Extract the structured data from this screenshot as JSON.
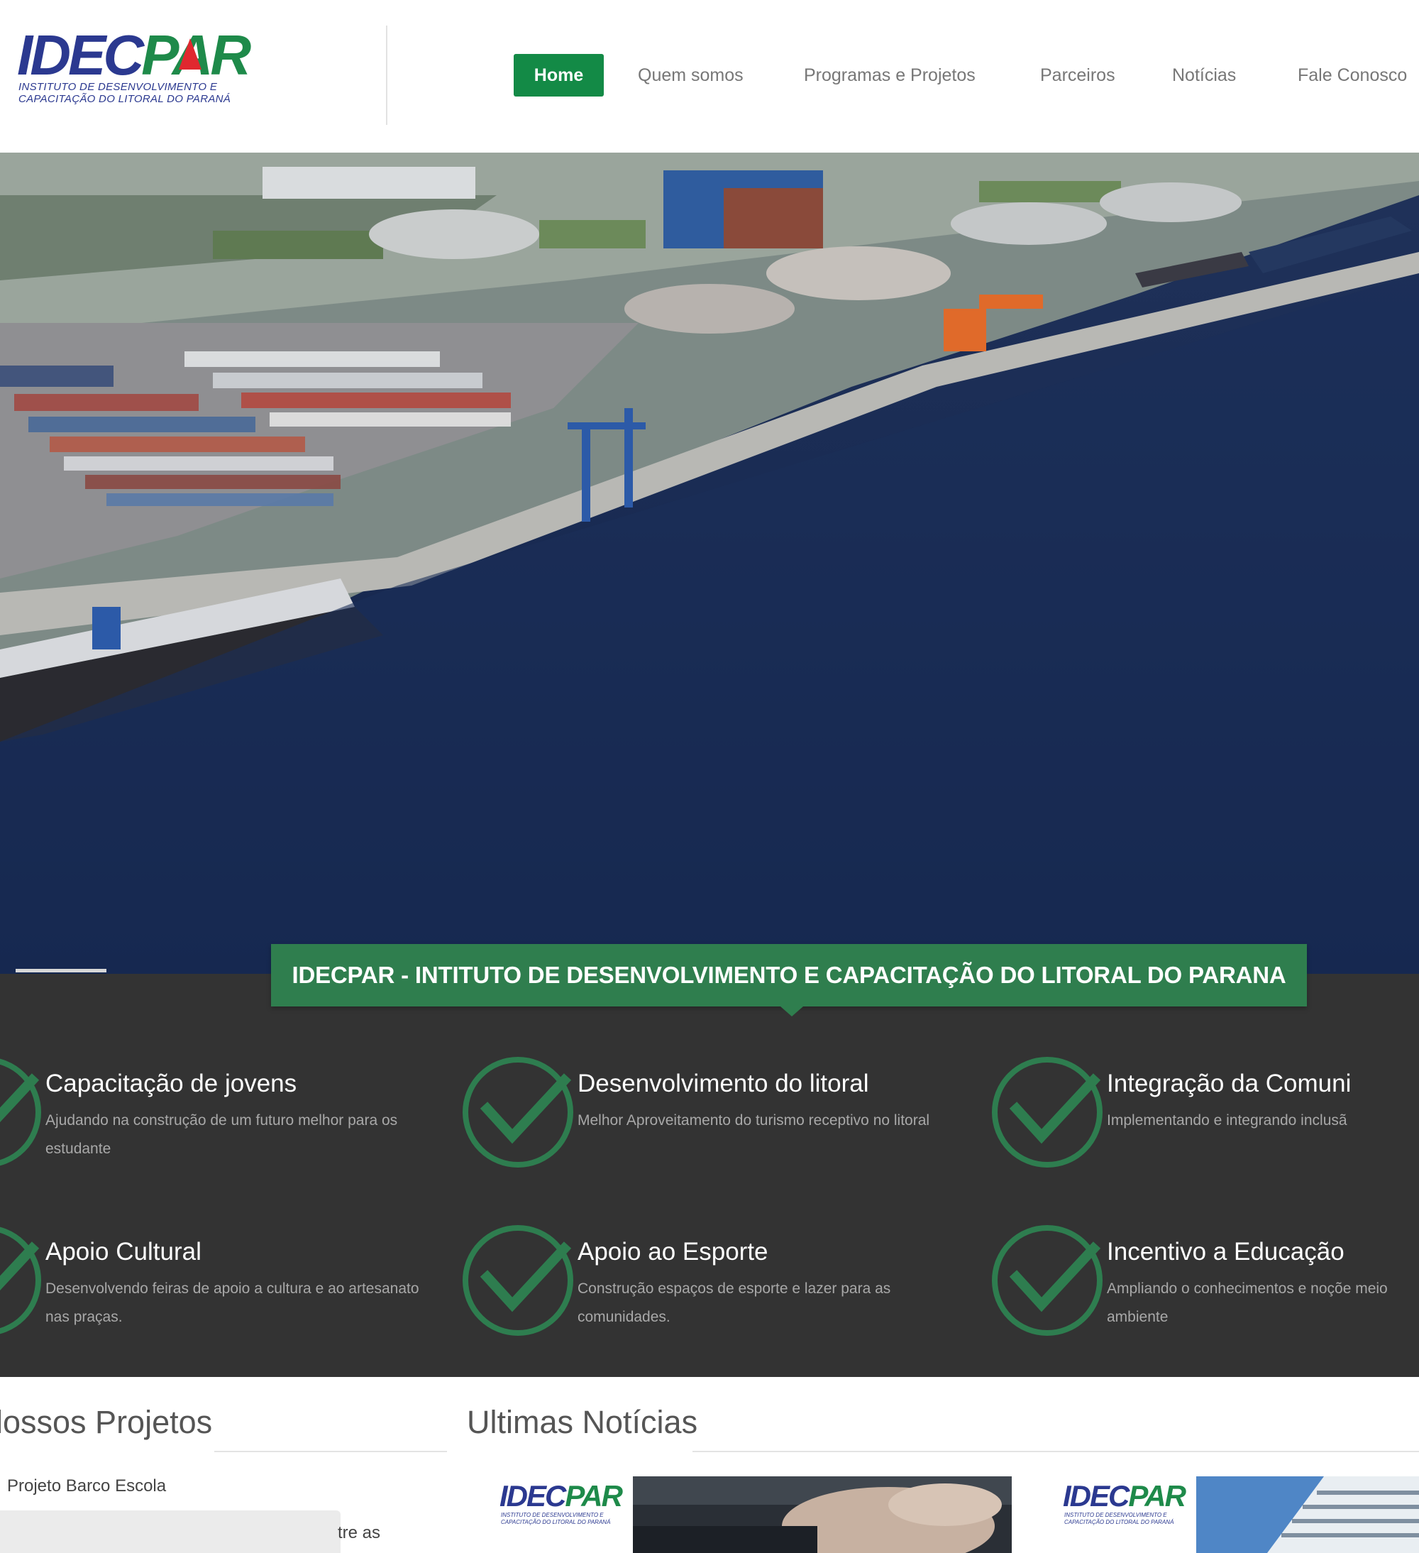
{
  "brand": {
    "logo_word_part1": "IDEC",
    "logo_word_part2": "PAR",
    "logo_subtitle": "Instituto de Desenvolvimento e Capacitação do Litoral do Paraná",
    "blue": "#2b3990",
    "green": "#1e8a4a",
    "red": "#e0282f"
  },
  "nav": {
    "items": [
      {
        "label": "Home",
        "active": true
      },
      {
        "label": "Quem somos",
        "active": false
      },
      {
        "label": "Programas e Projetos",
        "active": false
      },
      {
        "label": "Parceiros",
        "active": false
      },
      {
        "label": "Notícias",
        "active": false
      },
      {
        "label": "Fale Conosco",
        "active": false
      }
    ],
    "active_color": "#138a46"
  },
  "hero": {
    "image_icon": "port-aerial-photo",
    "caption": "IDECPAR - INTITUTO DE DESENVOLVIMENTO E CAPACITAÇÃO DO LITORAL DO PARANA"
  },
  "features": {
    "icon": "check-circle-icon",
    "items": [
      {
        "title": "Capacitação de jovens",
        "desc": "Ajudando na construção de um futuro melhor para os estudante"
      },
      {
        "title": "Desenvolvimento do litoral",
        "desc": "Melhor Aproveitamento do turismo receptivo no litoral"
      },
      {
        "title": "Integração da Comuni",
        "desc": "Implementando e integrando inclusã"
      },
      {
        "title": "Apoio Cultural",
        "desc": "Desenvolvendo feiras de apoio a cultura e ao artesanato nas praças."
      },
      {
        "title": "Apoio ao Esporte",
        "desc": "Construção espaços de esporte e lazer para as comunidades."
      },
      {
        "title": "Incentivo a Educação",
        "desc": "Ampliando o conhecimentos e noçõe meio ambiente"
      }
    ],
    "band_color": "#333333",
    "accent": "#2f7e4e"
  },
  "projects": {
    "title": "lossos Projetos",
    "item": "Projeto Barco Escola",
    "text_fragment": "tre as"
  },
  "news": {
    "title": "Ultimas Notícias",
    "cards": [
      {
        "logo_part1": "IDEC",
        "logo_part2": "PAR",
        "logo_sub": "Instituto de Desenvolvimento e Capacitação do Litoral do Paraná"
      },
      {
        "logo_part1": "IDEC",
        "logo_part2": "PAR",
        "logo_sub": "Instituto de Desenvolvimento e Capacitação do Litoral do Paraná"
      }
    ]
  }
}
